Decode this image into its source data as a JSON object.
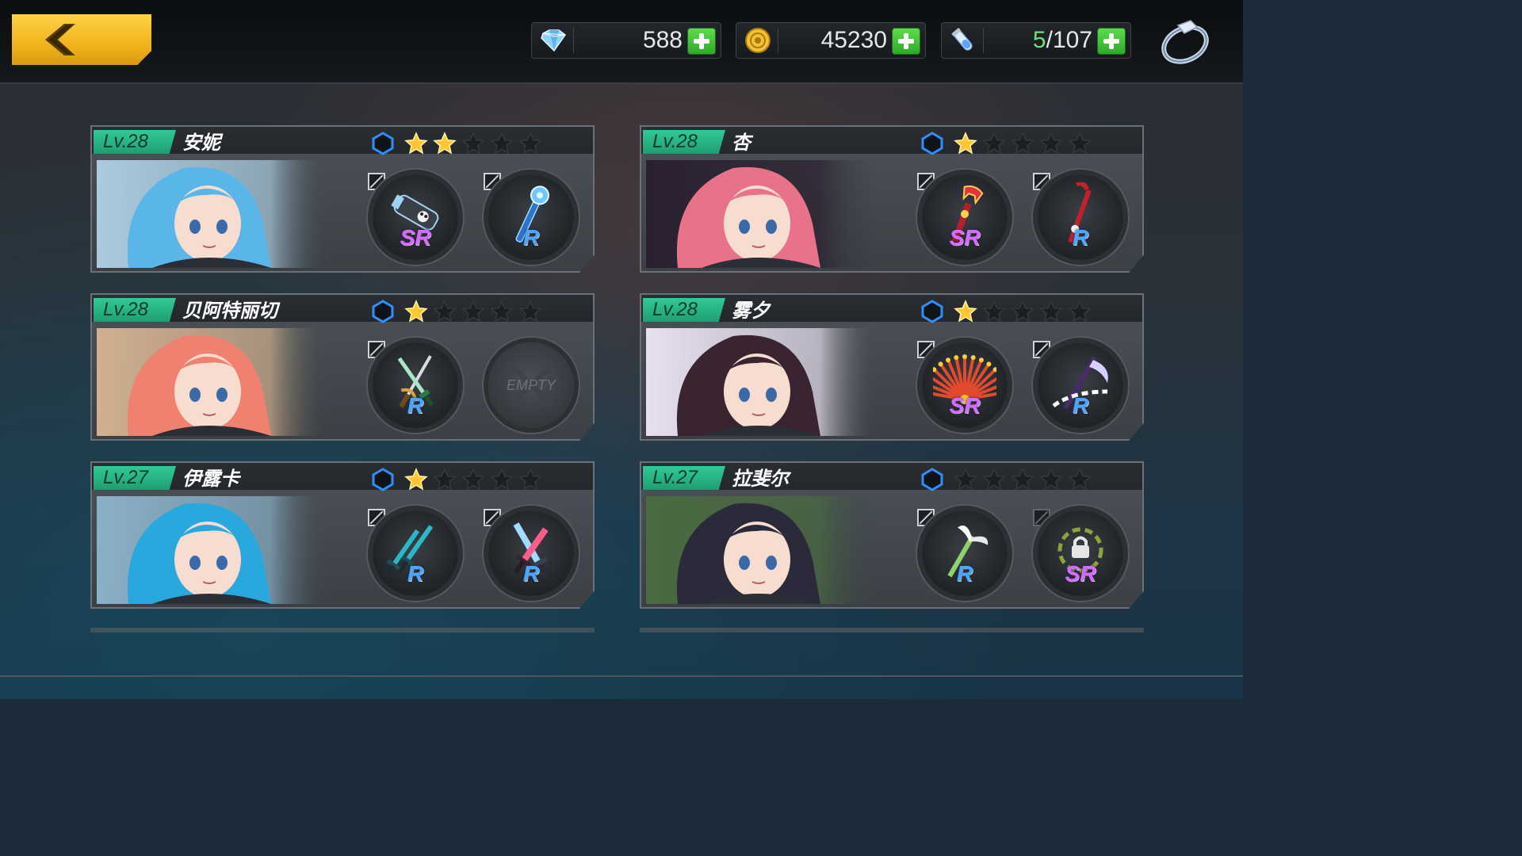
{
  "resources": {
    "gems": {
      "value": "588",
      "icon": "diamond-icon"
    },
    "gold": {
      "value": "45230",
      "icon": "coin-icon"
    },
    "stamina": {
      "current": "5",
      "max": "/107",
      "icon": "potion-icon"
    }
  },
  "characters": [
    {
      "level": "Lv.28",
      "name": "安妮",
      "stars": 2,
      "hair": "#5ab6e8",
      "slots": [
        {
          "rarity": "SR",
          "weapon": "cannon"
        },
        {
          "rarity": "R",
          "weapon": "staff"
        }
      ]
    },
    {
      "level": "Lv.28",
      "name": "杏",
      "stars": 1,
      "hair": "#e8728a",
      "slots": [
        {
          "rarity": "SR",
          "weapon": "wrench"
        },
        {
          "rarity": "R",
          "weapon": "crowbar"
        }
      ]
    },
    {
      "level": "Lv.28",
      "name": "贝阿特丽切",
      "stars": 1,
      "hair": "#f08070",
      "slots": [
        {
          "rarity": "R",
          "weapon": "rapier"
        },
        {
          "rarity": "",
          "weapon": "empty",
          "empty_label": "EMPTY"
        }
      ]
    },
    {
      "level": "Lv.28",
      "name": "雾夕",
      "stars": 1,
      "hair": "#3b2432",
      "slots": [
        {
          "rarity": "SR",
          "weapon": "fan"
        },
        {
          "rarity": "R",
          "weapon": "scythe"
        }
      ]
    },
    {
      "level": "Lv.27",
      "name": "伊露卡",
      "stars": 1,
      "hair": "#28a8dc",
      "slots": [
        {
          "rarity": "R",
          "weapon": "daggers"
        },
        {
          "rarity": "R",
          "weapon": "sword"
        }
      ]
    },
    {
      "level": "Lv.27",
      "name": "拉斐尔",
      "stars": 0,
      "hair": "#2a2a3a",
      "slots": [
        {
          "rarity": "R",
          "weapon": "wings"
        },
        {
          "rarity": "SR",
          "weapon": "locked"
        }
      ]
    }
  ]
}
